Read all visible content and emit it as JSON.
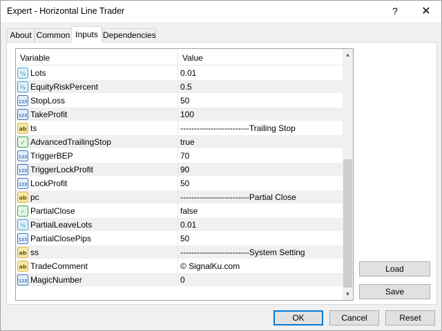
{
  "window": {
    "title": "Expert - Horizontal Line Trader",
    "help_label": "?",
    "close_label": "✕"
  },
  "tabs": [
    {
      "label": "About"
    },
    {
      "label": "Common"
    },
    {
      "label": "Inputs",
      "active": true
    },
    {
      "label": "Dependencies"
    }
  ],
  "grid": {
    "columns": {
      "variable": "Variable",
      "value": "Value"
    },
    "rows": [
      {
        "icon": "double-icon",
        "name": "Lots",
        "value": "0.01"
      },
      {
        "icon": "double-icon",
        "name": "EquityRiskPercent",
        "value": "0.5"
      },
      {
        "icon": "int-icon",
        "name": "StopLoss",
        "value": "50"
      },
      {
        "icon": "int-icon",
        "name": "TakeProfit",
        "value": "100"
      },
      {
        "icon": "string-icon",
        "name": "ts",
        "value": "-------------------------Trailing Stop"
      },
      {
        "icon": "bool-icon",
        "name": "AdvancedTrailingStop",
        "value": "true"
      },
      {
        "icon": "int-icon",
        "name": "TriggerBEP",
        "value": "70"
      },
      {
        "icon": "int-icon",
        "name": "TriggerLockProfit",
        "value": "90"
      },
      {
        "icon": "int-icon",
        "name": "LockProfit",
        "value": "50"
      },
      {
        "icon": "string-icon",
        "name": "pc",
        "value": "-------------------------Partial Close"
      },
      {
        "icon": "bool-icon",
        "name": "PartialClose",
        "value": "false"
      },
      {
        "icon": "double-icon",
        "name": "PartialLeaveLots",
        "value": "0.01"
      },
      {
        "icon": "int-icon",
        "name": "PartialClosePips",
        "value": "50"
      },
      {
        "icon": "string-icon",
        "name": "ss",
        "value": "-------------------------System Setting"
      },
      {
        "icon": "string-icon",
        "name": "TradeComment",
        "value": "© SignalKu.com"
      },
      {
        "icon": "int-icon",
        "name": "MagicNumber",
        "value": "0"
      }
    ]
  },
  "side_buttons": {
    "load": "Load",
    "save": "Save"
  },
  "footer_buttons": {
    "ok": "OK",
    "cancel": "Cancel",
    "reset": "Reset"
  },
  "icon_labels": {
    "double": "½",
    "int": "123",
    "string": "ab",
    "bool": "✓"
  },
  "colors": {
    "double_icon": "#3aa7d8",
    "int_icon": "#3f6fb8",
    "string_icon": "#d9b94a",
    "bool_icon": "#3aa64a",
    "primary_border": "#0078d7"
  }
}
